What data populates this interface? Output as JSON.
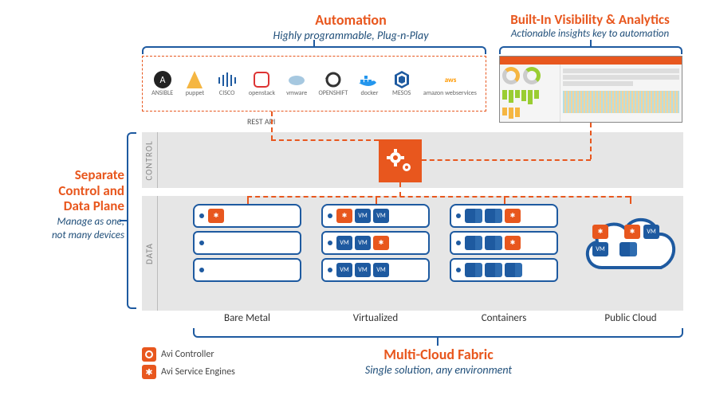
{
  "automation": {
    "title": "Automation",
    "subtitle": "Highly programmable, Plug-n-Play",
    "rest_api_label": "REST API",
    "partners": [
      "ANSIBLE",
      "puppet",
      "CISCO",
      "openstack",
      "vmware",
      "OPENSHIFT",
      "docker",
      "MESOS",
      "amazon webservices"
    ]
  },
  "visibility": {
    "title": "Built-In Visibility & Analytics",
    "subtitle": "Actionable insights key to automation"
  },
  "separate": {
    "line1": "Separate",
    "line2": "Control and",
    "line3": "Data Plane",
    "sub1": "Manage as one,",
    "sub2": "not many devices"
  },
  "planes": {
    "control": "CONTROL",
    "data": "DATA"
  },
  "environments": {
    "bare_metal": "Bare Metal",
    "virtualized": "Virtualized",
    "containers": "Containers",
    "public_cloud": "Public Cloud"
  },
  "multicloud": {
    "title": "Multi-Cloud Fabric",
    "subtitle": "Single solution, any environment"
  },
  "legend": {
    "controller": "Avi Controller",
    "service_engine": "Avi Service Engines"
  },
  "chips": {
    "vm": "VM",
    "se": "✱"
  }
}
